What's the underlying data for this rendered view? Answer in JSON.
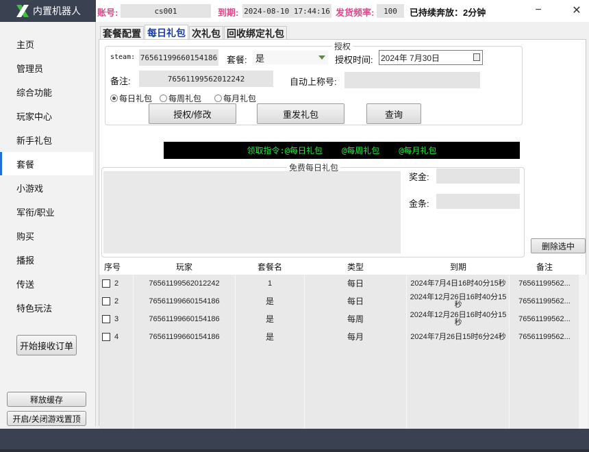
{
  "app": {
    "title": "内置机器人"
  },
  "header": {
    "account_label": "账号:",
    "account_value": "cs001",
    "expire_label": "到期:",
    "expire_value": "2024-08-10 17:44:16",
    "freq_label": "发货频率:",
    "freq_value": "100",
    "status_text": "已持续奔放：2分钟",
    "minimize": "−",
    "close": "✕"
  },
  "sidebar": {
    "items": [
      {
        "label": "主页"
      },
      {
        "label": "管理员"
      },
      {
        "label": "综合功能"
      },
      {
        "label": "玩家中心"
      },
      {
        "label": "新手礼包"
      },
      {
        "label": "套餐"
      },
      {
        "label": "小游戏"
      },
      {
        "label": "军衔/职业"
      },
      {
        "label": "购买"
      },
      {
        "label": "播报"
      },
      {
        "label": "传送"
      },
      {
        "label": "特色玩法"
      }
    ],
    "active_index": 5,
    "start_orders": "开始接收订单",
    "release_cache": "释放缓存",
    "toggle_topmost": "开启/关闭游戏置顶"
  },
  "tabs": [
    {
      "label": "套餐配置"
    },
    {
      "label": "每日礼包"
    },
    {
      "label": "次礼包"
    },
    {
      "label": "回收绑定礼包"
    }
  ],
  "auth": {
    "group_title": "授权",
    "steam_label": "steam:",
    "steam_value": "76561199660154186",
    "package_label": "套餐:",
    "package_value": "是",
    "auth_time_label": "授权时间:",
    "auth_time_value": "2024年  7月30日",
    "note_label": "备注:",
    "note_value": "76561199562012242",
    "auto_title_label": "自动上称号:",
    "auto_title_value": "",
    "radio_daily": "每日礼包",
    "radio_weekly": "每周礼包",
    "radio_monthly": "每月礼包",
    "btn_authorize": "授权/修改",
    "btn_resend": "重发礼包",
    "btn_query": "查询"
  },
  "command": {
    "prefix": "领取指令:",
    "daily": "@每日礼包",
    "weekly": "@每周礼包",
    "monthly": "@每月礼包"
  },
  "free_daily": {
    "group_title": "免费每日礼包",
    "bonus_label": "奖金:",
    "bonus_value": "",
    "balance_label": "金条:",
    "balance_value": "",
    "delete_selected": "删除选中"
  },
  "table": {
    "columns": [
      "序号",
      "玩家",
      "套餐名",
      "类型",
      "到期",
      "备注"
    ],
    "rows": [
      {
        "id": "2",
        "player": "76561199562012242",
        "package": "1",
        "type": "每日",
        "expire": "2024年7月4日16时40分15秒",
        "note": "76561199562..."
      },
      {
        "id": "2",
        "player": "76561199660154186",
        "package": "是",
        "type": "每日",
        "expire": "2024年12月26日16时40分15秒",
        "note": "76561199562..."
      },
      {
        "id": "3",
        "player": "76561199660154186",
        "package": "是",
        "type": "每周",
        "expire": "2024年12月26日16时40分15秒",
        "note": "76561199562..."
      },
      {
        "id": "4",
        "player": "76561199660154186",
        "package": "是",
        "type": "每月",
        "expire": "2024年7月26日15时6分24秒",
        "note": "76561199562..."
      }
    ]
  },
  "colors": {
    "title_bg": "#3a4150",
    "header_label": "#e0458a",
    "accent": "#1f6fd6",
    "command_text": "#2ee64a"
  }
}
